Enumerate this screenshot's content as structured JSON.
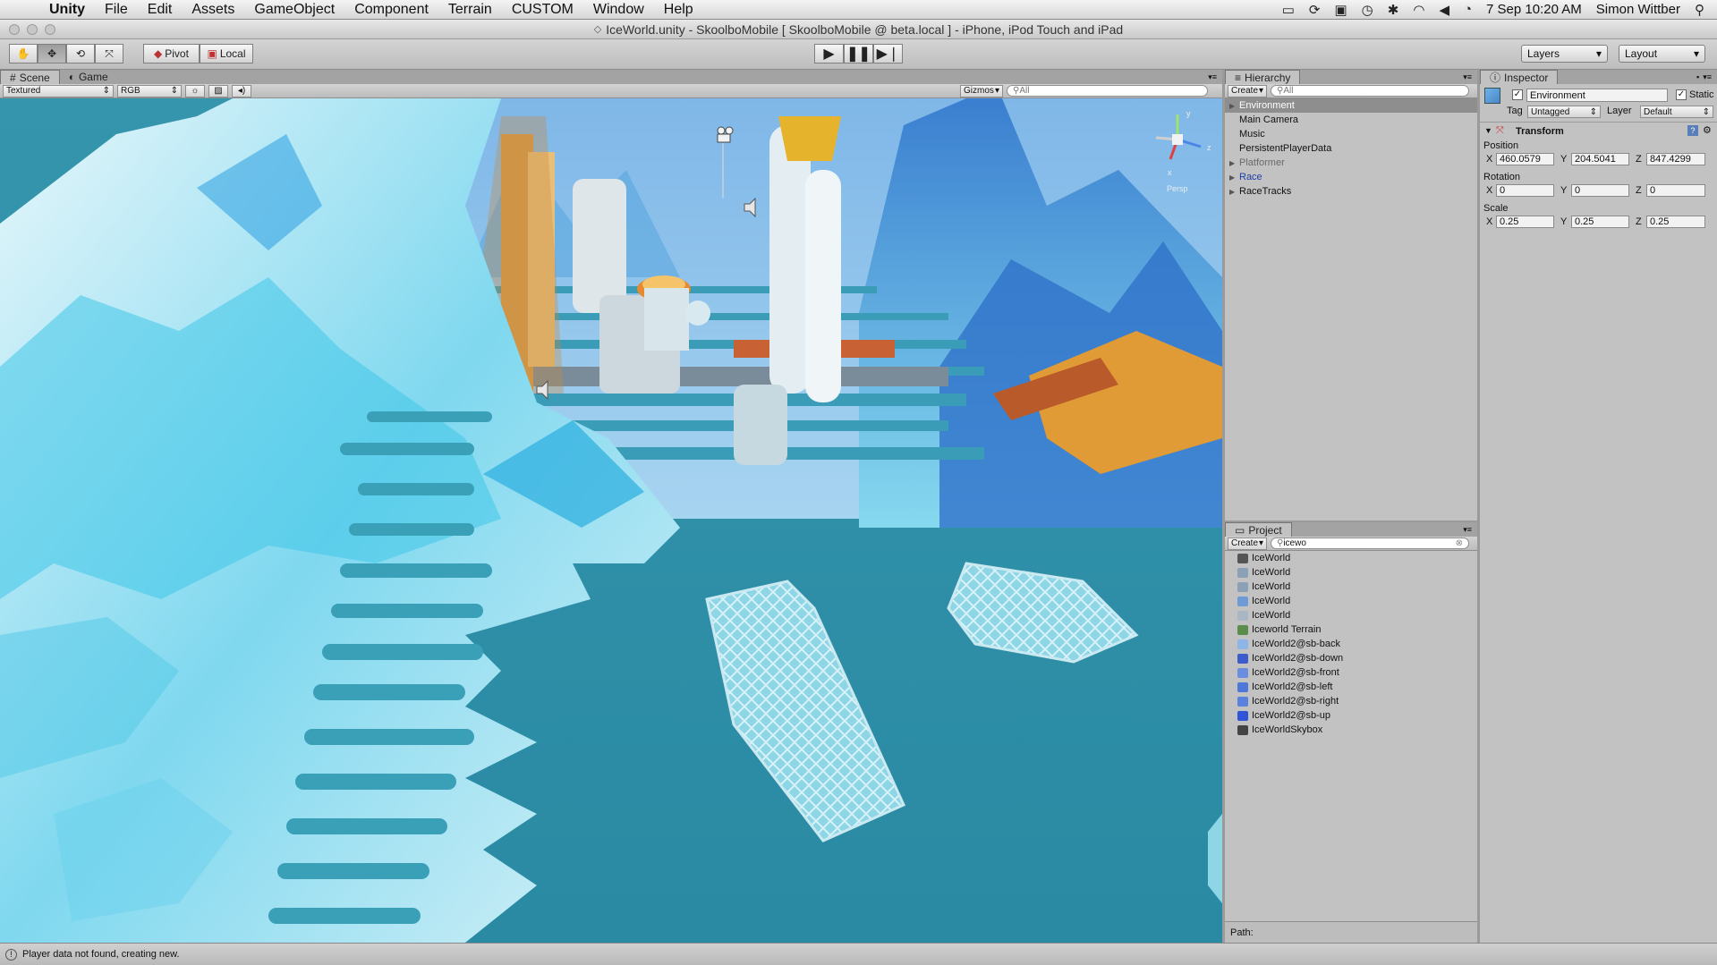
{
  "menubar": {
    "app_name": "Unity",
    "items": [
      "File",
      "Edit",
      "Assets",
      "GameObject",
      "Component",
      "Terrain",
      "CUSTOM",
      "Window",
      "Help"
    ],
    "date_time": "7 Sep 10:20 AM",
    "user": "Simon Wittber"
  },
  "window": {
    "title": "IceWorld.unity - SkoolboMobile [ SkoolboMobile @ beta.local ] - iPhone, iPod Touch and iPad"
  },
  "toolbar": {
    "pivot_label": "Pivot",
    "local_label": "Local",
    "layers_label": "Layers",
    "layout_label": "Layout",
    "play_icon": "play-icon",
    "pause_icon": "pause-icon",
    "step_icon": "step-icon"
  },
  "scene": {
    "tabs": [
      "Scene",
      "Game"
    ],
    "render_mode": "Textured",
    "color_mode": "RGB",
    "gizmos_label": "Gizmos",
    "search_placeholder": "All",
    "persp_label": "Persp",
    "axis_labels": {
      "y": "y",
      "z": "z",
      "x": "x"
    },
    "colors": {
      "water": "#3b9fba",
      "ice": "#bfeaf4",
      "sky": "#9ccaee"
    }
  },
  "hierarchy": {
    "tab": "Hierarchy",
    "create_label": "Create",
    "search_placeholder": "All",
    "items": [
      {
        "label": "Environment",
        "state": "selected",
        "expandable": true
      },
      {
        "label": "Main Camera",
        "state": "normal",
        "expandable": false
      },
      {
        "label": "Music",
        "state": "normal",
        "expandable": false
      },
      {
        "label": "PersistentPlayerData",
        "state": "normal",
        "expandable": false
      },
      {
        "label": "Platformer",
        "state": "disabled",
        "expandable": true
      },
      {
        "label": "Race",
        "state": "prefab",
        "expandable": true
      },
      {
        "label": "RaceTracks",
        "state": "normal",
        "expandable": true
      }
    ]
  },
  "project": {
    "tab": "Project",
    "create_label": "Create",
    "search_value": "icewo",
    "path_label": "Path:",
    "items": [
      {
        "label": "IceWorld",
        "icon": "unity-scene-icon",
        "color": "#555555"
      },
      {
        "label": "IceWorld",
        "icon": "folder-icon",
        "color": "#8aa1b8"
      },
      {
        "label": "IceWorld",
        "icon": "folder-icon",
        "color": "#8aa1b8"
      },
      {
        "label": "IceWorld",
        "icon": "prefab-icon",
        "color": "#6e9ad6"
      },
      {
        "label": "IceWorld",
        "icon": "terrain-data-icon",
        "color": "#a9b6c4"
      },
      {
        "label": "Iceworld Terrain",
        "icon": "terrain-icon",
        "color": "#5b8c4c"
      },
      {
        "label": "IceWorld2@sb-back",
        "icon": "texture-icon",
        "color": "#8fb4e8"
      },
      {
        "label": "IceWorld2@sb-down",
        "icon": "texture-icon",
        "color": "#3c5cc9"
      },
      {
        "label": "IceWorld2@sb-front",
        "icon": "texture-icon",
        "color": "#6a8de0"
      },
      {
        "label": "IceWorld2@sb-left",
        "icon": "texture-icon",
        "color": "#4f77da"
      },
      {
        "label": "IceWorld2@sb-right",
        "icon": "texture-icon",
        "color": "#5a82dc"
      },
      {
        "label": "IceWorld2@sb-up",
        "icon": "texture-icon",
        "color": "#2f55d6"
      },
      {
        "label": "IceWorldSkybox",
        "icon": "material-icon",
        "color": "#444444"
      }
    ]
  },
  "inspector": {
    "tab": "Inspector",
    "object_name": "Environment",
    "static_label": "Static",
    "tag_label": "Tag",
    "tag_value": "Untagged",
    "layer_label": "Layer",
    "layer_value": "Default",
    "component_title": "Transform",
    "position_label": "Position",
    "rotation_label": "Rotation",
    "scale_label": "Scale",
    "axis_x": "X",
    "axis_y": "Y",
    "axis_z": "Z",
    "position": {
      "x": "460.0579",
      "y": "204.5041",
      "z": "847.4299"
    },
    "rotation": {
      "x": "0",
      "y": "0",
      "z": "0"
    },
    "scale": {
      "x": "0.25",
      "y": "0.25",
      "z": "0.25"
    }
  },
  "status": {
    "message": "Player data not found, creating new."
  }
}
